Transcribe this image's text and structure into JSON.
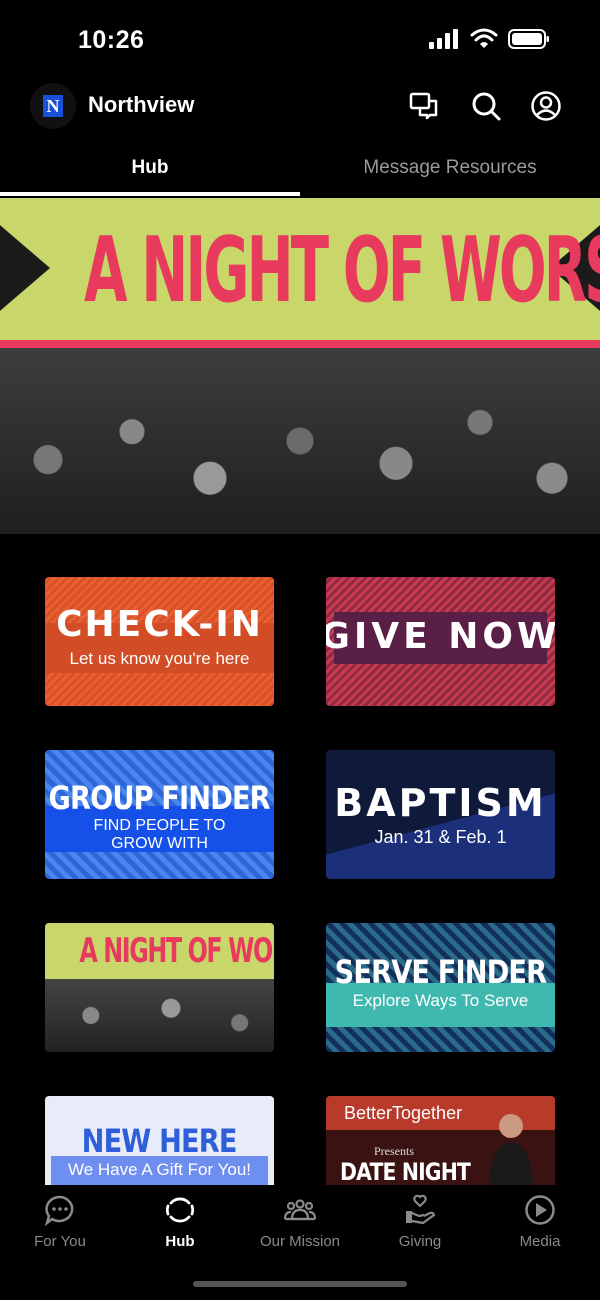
{
  "status_bar": {
    "time": "10:26"
  },
  "header": {
    "logo_letter": "N",
    "title": "Northview",
    "icons": [
      "chat-icon",
      "search-icon",
      "account-icon"
    ]
  },
  "tabs": [
    {
      "label": "Hub",
      "active": true
    },
    {
      "label": "Message Resources",
      "active": false
    }
  ],
  "hero": {
    "title": "A NIGHT OF WORSHIP"
  },
  "cards": {
    "checkin": {
      "title": "CHECK-IN",
      "subtitle": "Let us know you're here"
    },
    "give": {
      "title": "GIVE NOW"
    },
    "group": {
      "title": "GROUP FINDER",
      "subtitle_line1": "FIND PEOPLE TO",
      "subtitle_line2": "GROW WITH"
    },
    "baptism": {
      "title": "BAPTISM",
      "subtitle": "Jan. 31 & Feb. 1"
    },
    "worship": {
      "title": "A NIGHT OF WORSHIP"
    },
    "serve": {
      "title": "SERVE FINDER",
      "subtitle": "Explore Ways To Serve"
    },
    "newhere": {
      "title": "NEW HERE",
      "subtitle": "We Have A Gift For You!"
    },
    "date": {
      "brand": "BetterTogether",
      "presents": "Presents",
      "title": "DATE NIGHT"
    }
  },
  "bottom_nav": [
    {
      "label": "For You",
      "icon": "chat-bubble-icon",
      "active": false
    },
    {
      "label": "Hub",
      "icon": "hub-icon",
      "active": true
    },
    {
      "label": "Our Mission",
      "icon": "people-icon",
      "active": false
    },
    {
      "label": "Giving",
      "icon": "giving-hand-icon",
      "active": false
    },
    {
      "label": "Media",
      "icon": "play-icon",
      "active": false
    }
  ],
  "colors": {
    "background": "#000000",
    "accent_pink": "#e83a5d",
    "accent_lime": "#c9d66a",
    "inactive_text": "#9a9a9a"
  }
}
